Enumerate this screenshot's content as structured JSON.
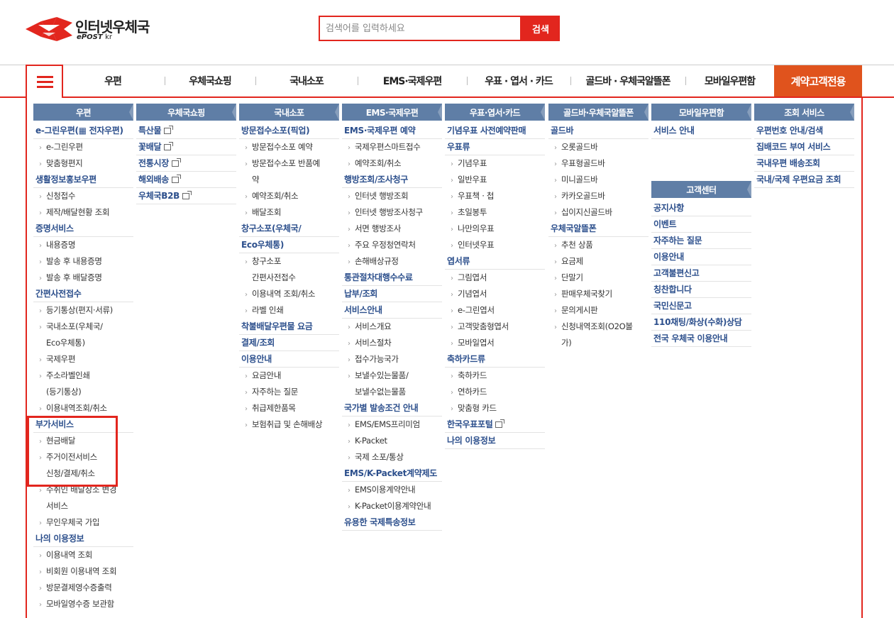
{
  "header": {
    "logo_name": "인터넷우체국",
    "logo_sub": "ePOST",
    "logo_sub_kr": "kr",
    "search_placeholder": "검색어를 입력하세요",
    "search_button": "검색"
  },
  "gnb": {
    "items": [
      "우편",
      "우체국쇼핑",
      "국내소포",
      "EMS·국제우편",
      "우표 · 엽서 · 카드",
      "골드바 · 우체국알뜰폰",
      "모바일우편함"
    ],
    "special": "계약고객전용"
  },
  "columns": [
    {
      "title": "우편",
      "items": [
        {
          "t": "m",
          "label": "e-그린우편(▦ 전자우편)"
        },
        {
          "t": "s",
          "label": "e-그린우편"
        },
        {
          "t": "s",
          "label": "맞춤형편지"
        },
        {
          "t": "m",
          "label": "생활정보홍보우편"
        },
        {
          "t": "s",
          "label": "신청접수"
        },
        {
          "t": "s",
          "label": "제작/배달현황 조회"
        },
        {
          "t": "m",
          "label": "증명서비스"
        },
        {
          "t": "s",
          "label": "내용증명"
        },
        {
          "t": "s",
          "label": "발송 후 내용증명"
        },
        {
          "t": "s",
          "label": "발송 후 배달증명"
        },
        {
          "t": "m",
          "label": "간편사전접수"
        },
        {
          "t": "s",
          "label": "등기통상(편지·서류)"
        },
        {
          "t": "s",
          "label": "국내소포(우체국/"
        },
        {
          "t": "c",
          "label": "Eco우체통)"
        },
        {
          "t": "s",
          "label": "국제우편"
        },
        {
          "t": "s",
          "label": "주소라벨인쇄"
        },
        {
          "t": "c",
          "label": "(등기통상)"
        },
        {
          "t": "s",
          "label": "이용내역조회/취소"
        },
        {
          "t": "m",
          "label": "부가서비스"
        },
        {
          "t": "s",
          "label": "현금배달"
        },
        {
          "t": "s",
          "label": "주거이전서비스"
        },
        {
          "t": "c",
          "label": "신청/결제/취소"
        },
        {
          "t": "s",
          "label": "수취인 배달장소 변경"
        },
        {
          "t": "c",
          "label": "서비스"
        },
        {
          "t": "s",
          "label": "무인우체국 가입"
        },
        {
          "t": "m",
          "label": "나의 이용정보"
        },
        {
          "t": "s",
          "label": "이용내역 조회"
        },
        {
          "t": "s",
          "label": "비회원 이용내역 조회"
        },
        {
          "t": "s",
          "label": "방문결제영수증출력"
        },
        {
          "t": "s",
          "label": "모바일영수증 보관함"
        }
      ]
    },
    {
      "title": "우체국쇼핑",
      "items": [
        {
          "t": "m",
          "label": "특산물",
          "ext": true
        },
        {
          "t": "m",
          "label": "꽃배달",
          "ext": true
        },
        {
          "t": "m",
          "label": "전통시장",
          "ext": true
        },
        {
          "t": "m",
          "label": "해외배송",
          "ext": true
        },
        {
          "t": "m",
          "label": "우체국B2B",
          "ext": true
        }
      ]
    },
    {
      "title": "국내소포",
      "items": [
        {
          "t": "m",
          "label": "방문접수소포(픽업)"
        },
        {
          "t": "s",
          "label": "방문접수소포 예약"
        },
        {
          "t": "s",
          "label": "방문접수소포 반품예"
        },
        {
          "t": "c",
          "label": "약"
        },
        {
          "t": "s",
          "label": "예약조회/취소"
        },
        {
          "t": "s",
          "label": "배달조회"
        },
        {
          "t": "m",
          "label": "창구소포(우체국/"
        },
        {
          "t": "m",
          "label": "Eco우체통)"
        },
        {
          "t": "s",
          "label": "창구소포"
        },
        {
          "t": "c",
          "label": "간편사전접수"
        },
        {
          "t": "s",
          "label": "이용내역 조회/취소"
        },
        {
          "t": "s",
          "label": "라벨 인쇄"
        },
        {
          "t": "m",
          "label": "착불배달우편물 요금"
        },
        {
          "t": "m",
          "label": "결제/조회"
        },
        {
          "t": "m",
          "label": "이용안내"
        },
        {
          "t": "s",
          "label": "요금안내"
        },
        {
          "t": "s",
          "label": "자주하는 질문"
        },
        {
          "t": "s",
          "label": "취급제한품목"
        },
        {
          "t": "s",
          "label": "보험취급 및 손해배상"
        }
      ]
    },
    {
      "title": "EMS·국제우편",
      "items": [
        {
          "t": "m",
          "label": "EMS·국제우편 예약"
        },
        {
          "t": "s",
          "label": "국제우편스마트접수"
        },
        {
          "t": "s",
          "label": "예약조회/취소"
        },
        {
          "t": "m",
          "label": "행방조회/조사청구"
        },
        {
          "t": "s",
          "label": "인터넷 행방조회"
        },
        {
          "t": "s",
          "label": "인터넷 행방조사청구"
        },
        {
          "t": "s",
          "label": "서면 행방조사"
        },
        {
          "t": "s",
          "label": "주요 우정청연락처"
        },
        {
          "t": "s",
          "label": "손해배상규정"
        },
        {
          "t": "m",
          "label": "통관절차대행수수료"
        },
        {
          "t": "m",
          "label": "납부/조회"
        },
        {
          "t": "m",
          "label": "서비스안내"
        },
        {
          "t": "s",
          "label": "서비스개요"
        },
        {
          "t": "s",
          "label": "서비스절차"
        },
        {
          "t": "s",
          "label": "접수가능국가"
        },
        {
          "t": "s",
          "label": "보낼수있는물품/"
        },
        {
          "t": "c",
          "label": "보낼수없는물품"
        },
        {
          "t": "m",
          "label": "국가별 발송조건 안내"
        },
        {
          "t": "s",
          "label": "EMS/EMS프리미엄"
        },
        {
          "t": "s",
          "label": "K-Packet"
        },
        {
          "t": "s",
          "label": "국제 소포/통상"
        },
        {
          "t": "m",
          "label": "EMS/K-Packet계약제도"
        },
        {
          "t": "s",
          "label": "EMS이용계약안내"
        },
        {
          "t": "s",
          "label": "K-Packet이용계약안내"
        },
        {
          "t": "m",
          "label": "유용한 국제특송정보"
        }
      ]
    },
    {
      "title": "우표·엽서·카드",
      "items": [
        {
          "t": "m",
          "label": "기념우표 사전예약판매"
        },
        {
          "t": "m",
          "label": "우표류"
        },
        {
          "t": "s",
          "label": "기념우표"
        },
        {
          "t": "s",
          "label": "일반우표"
        },
        {
          "t": "s",
          "label": "우표책 · 첩"
        },
        {
          "t": "s",
          "label": "초일봉투"
        },
        {
          "t": "s",
          "label": "나만의우표"
        },
        {
          "t": "s",
          "label": "인터넷우표"
        },
        {
          "t": "m",
          "label": "엽서류"
        },
        {
          "t": "s",
          "label": "그림엽서"
        },
        {
          "t": "s",
          "label": "기념엽서"
        },
        {
          "t": "s",
          "label": "e-그린엽서"
        },
        {
          "t": "s",
          "label": "고객맞춤형엽서"
        },
        {
          "t": "s",
          "label": "모바일엽서"
        },
        {
          "t": "m",
          "label": "축하카드류"
        },
        {
          "t": "s",
          "label": "축하카드"
        },
        {
          "t": "s",
          "label": "연하카드"
        },
        {
          "t": "s",
          "label": "맞춤형 카드"
        },
        {
          "t": "m",
          "label": "한국우표포털",
          "ext": true
        },
        {
          "t": "m",
          "label": "나의 이용정보"
        }
      ]
    },
    {
      "title": "골드바·우체국알뜰폰",
      "items": [
        {
          "t": "m",
          "label": "골드바"
        },
        {
          "t": "s",
          "label": "오롯골드바"
        },
        {
          "t": "s",
          "label": "우표형골드바"
        },
        {
          "t": "s",
          "label": "미니골드바"
        },
        {
          "t": "s",
          "label": "카카오골드바"
        },
        {
          "t": "s",
          "label": "십이지신골드바"
        },
        {
          "t": "m",
          "label": "우체국알뜰폰"
        },
        {
          "t": "s",
          "label": "추천 상품"
        },
        {
          "t": "s",
          "label": "요금제"
        },
        {
          "t": "s",
          "label": "단말기"
        },
        {
          "t": "s",
          "label": "판매우체국찾기"
        },
        {
          "t": "s",
          "label": "문의게시판"
        },
        {
          "t": "s",
          "label": "신청내역조회(O2O볼"
        },
        {
          "t": "c",
          "label": "가)"
        }
      ]
    },
    {
      "title": "모바일우편함",
      "items": [
        {
          "t": "m",
          "label": "서비스 안내"
        }
      ],
      "title2": "고객센터",
      "items2": [
        {
          "t": "m",
          "label": "공지사항"
        },
        {
          "t": "m",
          "label": "이벤트"
        },
        {
          "t": "m",
          "label": "자주하는 질문"
        },
        {
          "t": "m",
          "label": "이용안내"
        },
        {
          "t": "m",
          "label": "고객불편신고"
        },
        {
          "t": "m",
          "label": "칭찬합니다"
        },
        {
          "t": "m",
          "label": "국민신문고"
        },
        {
          "t": "m",
          "label": "110채팅/화상(수화)상담"
        },
        {
          "t": "m",
          "label": "전국 우체국 이용안내"
        }
      ]
    },
    {
      "title": "조회 서비스",
      "items": [
        {
          "t": "m",
          "label": "우편번호 안내/검색"
        },
        {
          "t": "m",
          "label": "집배코드 부여 서비스"
        },
        {
          "t": "m",
          "label": "국내우편 배송조회"
        },
        {
          "t": "m",
          "label": "국내/국제 우편요금 조회"
        }
      ]
    }
  ]
}
